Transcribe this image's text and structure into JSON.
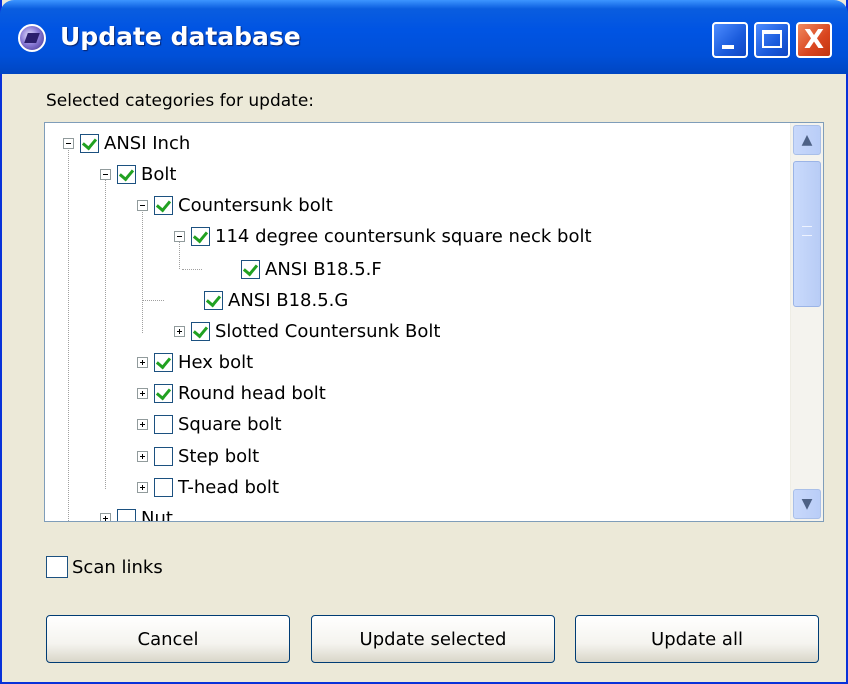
{
  "window": {
    "title": "Update database",
    "icon": "app-database-icon"
  },
  "titlebar_buttons": {
    "minimize_icon": "minimize-icon",
    "maximize_icon": "maximize-icon",
    "close_glyph": "X"
  },
  "tree": {
    "label": "Selected categories for update:",
    "nodes": [
      {
        "label": "ANSI Inch",
        "checked": true,
        "expander": "minus"
      },
      {
        "label": "Bolt",
        "checked": true,
        "expander": "minus"
      },
      {
        "label": "Countersunk bolt",
        "checked": true,
        "expander": "minus"
      },
      {
        "label": "114 degree countersunk square neck bolt",
        "checked": true,
        "expander": "minus"
      },
      {
        "label": "ANSI B18.5.F",
        "checked": true,
        "expander": "none"
      },
      {
        "label": "ANSI B18.5.G",
        "checked": true,
        "expander": "none"
      },
      {
        "label": "Slotted Countersunk Bolt",
        "checked": true,
        "expander": "plus"
      },
      {
        "label": "Hex bolt",
        "checked": true,
        "expander": "plus"
      },
      {
        "label": "Round head bolt",
        "checked": true,
        "expander": "plus"
      },
      {
        "label": "Square bolt",
        "checked": false,
        "expander": "plus"
      },
      {
        "label": "Step bolt",
        "checked": false,
        "expander": "plus"
      },
      {
        "label": "T-head bolt",
        "checked": false,
        "expander": "plus"
      },
      {
        "label": "Nut",
        "checked": false,
        "expander": "plus"
      }
    ]
  },
  "scan_links": {
    "label": "Scan links",
    "checked": false
  },
  "buttons": {
    "cancel": "Cancel",
    "update_selected": "Update selected",
    "update_all": "Update all"
  },
  "colors": {
    "titlebar": "#0054e3",
    "check": "#21a121",
    "close": "#d9451f"
  }
}
